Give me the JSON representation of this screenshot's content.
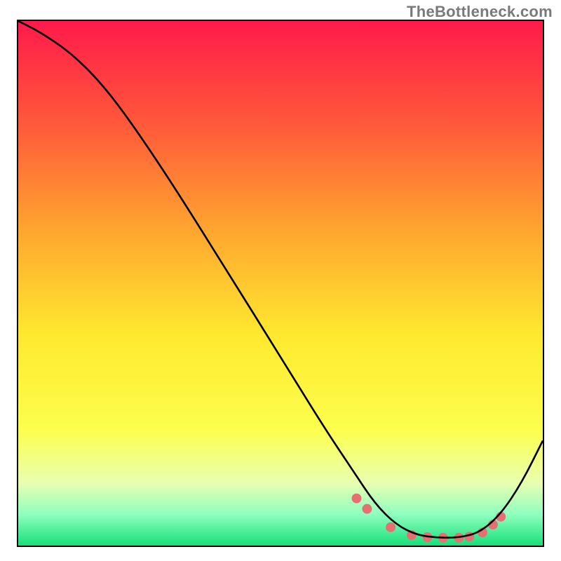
{
  "watermark": "TheBottleneck.com",
  "chart_data": {
    "type": "line",
    "title": "",
    "xlabel": "",
    "ylabel": "",
    "xlim": [
      0,
      100
    ],
    "ylim": [
      0,
      100
    ],
    "gradient_stops": [
      {
        "offset": 0,
        "color": "#ff1a4a"
      },
      {
        "offset": 20,
        "color": "#ff5a3a"
      },
      {
        "offset": 40,
        "color": "#ffa62f"
      },
      {
        "offset": 60,
        "color": "#ffe92f"
      },
      {
        "offset": 78,
        "color": "#fcff4d"
      },
      {
        "offset": 88,
        "color": "#e9ffb0"
      },
      {
        "offset": 94,
        "color": "#8fffbf"
      },
      {
        "offset": 100,
        "color": "#17e07a"
      }
    ],
    "series": [
      {
        "name": "curve",
        "x": [
          0,
          4,
          10,
          16,
          22,
          30,
          40,
          50,
          58,
          64,
          68,
          72,
          76,
          80,
          84,
          88,
          92,
          96,
          100
        ],
        "y": [
          100,
          98,
          94,
          88,
          80,
          68,
          52,
          36,
          23,
          14,
          8,
          4,
          2,
          1.5,
          1.5,
          2.5,
          6,
          12,
          20
        ]
      }
    ],
    "markers": {
      "name": "highlight-points",
      "color": "#e76f6f",
      "radius": 7,
      "x": [
        64.5,
        66.5,
        71,
        75,
        78,
        81,
        84,
        86,
        88.5,
        90.5,
        92
      ],
      "y": [
        9,
        7,
        3.5,
        2,
        1.6,
        1.5,
        1.5,
        1.7,
        2.5,
        4,
        5.5
      ]
    }
  }
}
